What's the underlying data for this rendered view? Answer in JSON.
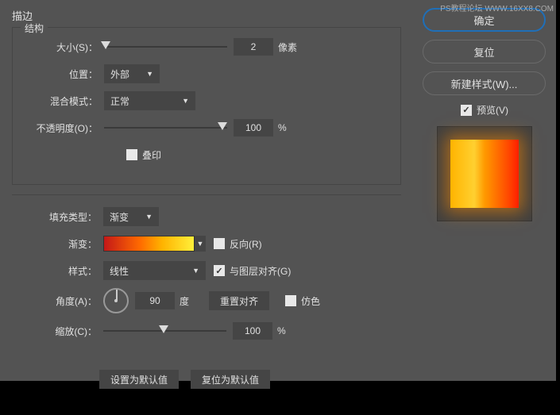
{
  "watermark": "PS教程论坛 WWW.16XX8.COM",
  "title": "描边",
  "structure": {
    "legend": "结构",
    "size_label": "大小(S)：",
    "size_value": "2",
    "size_unit": "像素",
    "position_label": "位置：",
    "position_value": "外部",
    "blend_label": "混合模式：",
    "blend_value": "正常",
    "opacity_label": "不透明度(O)：",
    "opacity_value": "100",
    "opacity_unit": "%",
    "overprint_label": "叠印"
  },
  "fill": {
    "type_label": "填充类型：",
    "type_value": "渐变",
    "gradient_label": "渐变：",
    "reverse_label": "反向(R)",
    "style_label": "样式：",
    "style_value": "线性",
    "align_label": "与图层对齐(G)",
    "angle_label": "角度(A)：",
    "angle_value": "90",
    "angle_unit": "度",
    "reset_align": "重置对齐",
    "dither_label": "仿色",
    "scale_label": "缩放(C)：",
    "scale_value": "100",
    "scale_unit": "%"
  },
  "buttons": {
    "set_default": "设置为默认值",
    "reset_default": "复位为默认值",
    "ok": "确定",
    "reset": "复位",
    "new_style": "新建样式(W)...",
    "preview": "预览(V)"
  }
}
